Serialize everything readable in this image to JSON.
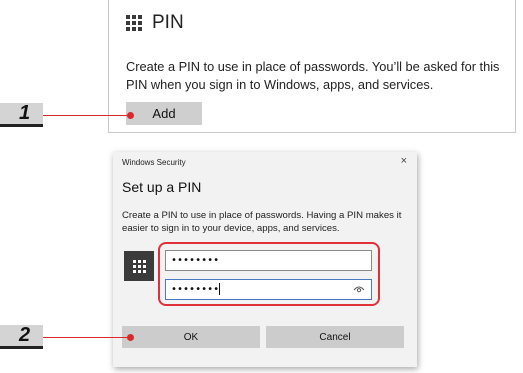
{
  "pin_section": {
    "title": "PIN",
    "description": "Create a PIN to use in place of passwords. You’ll be asked for this PIN when you sign in to Windows, apps, and services.",
    "add_label": "Add"
  },
  "steps": [
    {
      "number": "1"
    },
    {
      "number": "2"
    }
  ],
  "dialog": {
    "window_title": "Windows Security",
    "close_glyph": "×",
    "heading": "Set up a PIN",
    "description": "Create a PIN to use in place of passwords. Having a PIN makes it easier to sign in to your device, apps, and services.",
    "new_pin_value": "••••••••",
    "confirm_pin_value": "••••••••",
    "ok_label": "OK",
    "cancel_label": "Cancel"
  },
  "icons": [
    "keypad-icon",
    "close-icon",
    "eye-icon"
  ],
  "colors": {
    "accent_red": "#d92a2a",
    "button_gray": "#cccccc",
    "focus_blue": "#4a78c0"
  }
}
